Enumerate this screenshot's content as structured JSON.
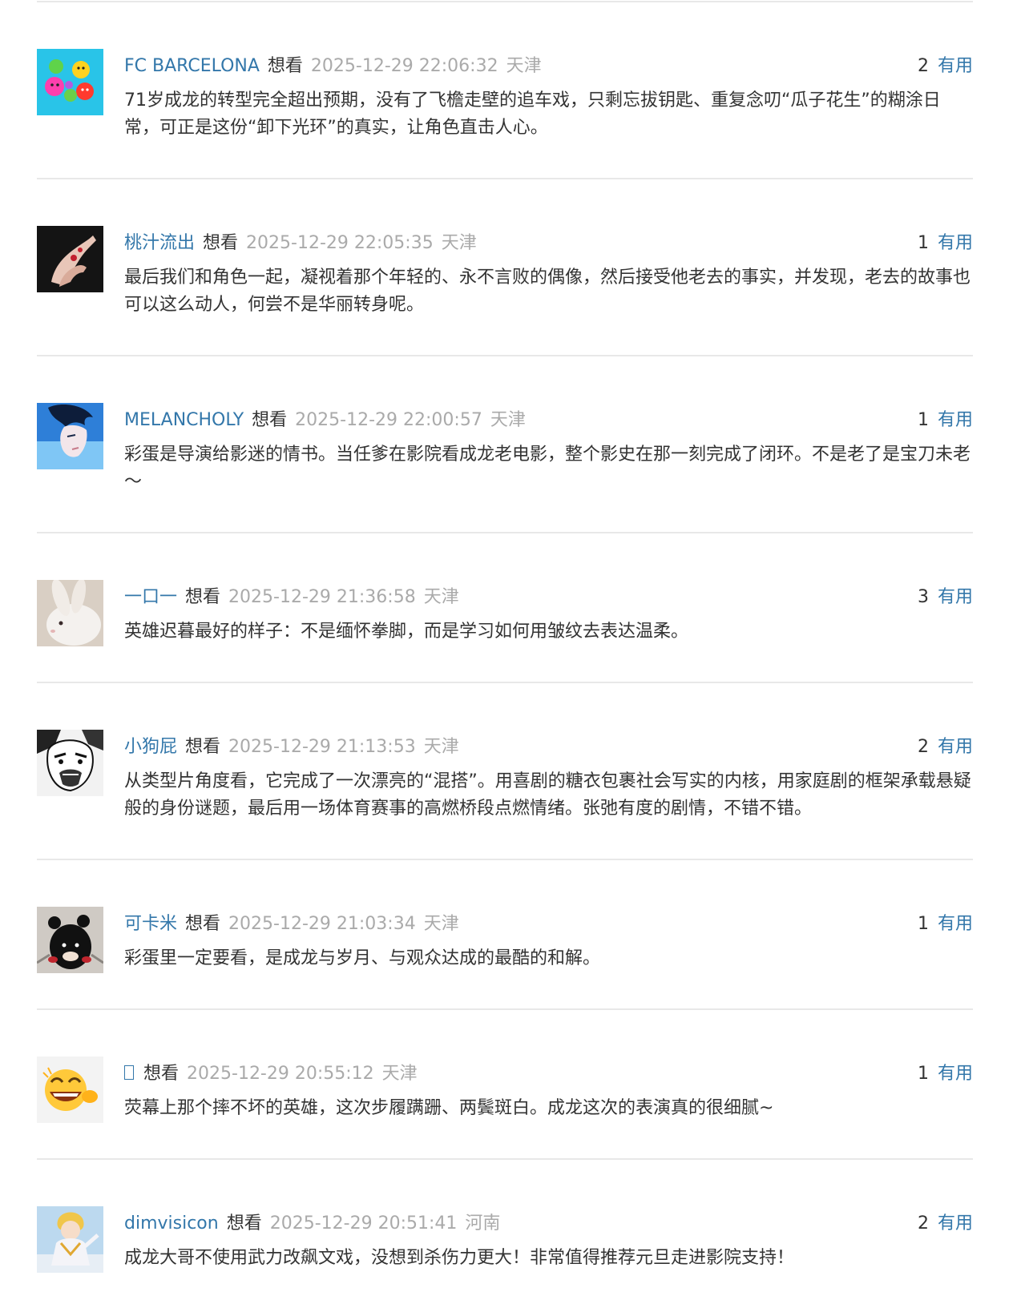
{
  "comments": [
    {
      "user": "FC BARCELONA",
      "rating": "想看",
      "time": "2025-12-29 22:06:32",
      "location": "天津",
      "useful_count": "2",
      "useful_label": "有用",
      "text": "71岁成龙的转型完全超出预期，没有了飞檐走壁的追车戏，只剩忘拔钥匙、重复念叨“瓜子花生”的糊涂日常，可正是这份“卸下光环”的真实，让角色直击人心。",
      "avatar": "colorful-balls-avatar"
    },
    {
      "user": "桃汁流出",
      "rating": "想看",
      "time": "2025-12-29 22:05:35",
      "location": "天津",
      "useful_count": "1",
      "useful_label": "有用",
      "text": "最后我们和角色一起，凝视着那个年轻的、永不言败的偶像，然后接受他老去的事实，并发现，老去的故事也可以这么动人，何尝不是华丽转身呢。",
      "avatar": "hands-dark-avatar"
    },
    {
      "user": "MELANCHOLY",
      "rating": "想看",
      "time": "2025-12-29 22:00:57",
      "location": "天津",
      "useful_count": "1",
      "useful_label": "有用",
      "text": "彩蛋是导演给影迷的情书。当任爹在影院看成龙老电影，整个影史在那一刻完成了闭环。不是老了是宝刀未老～",
      "avatar": "anime-boy-avatar"
    },
    {
      "user": "一口一",
      "rating": "想看",
      "time": "2025-12-29 21:36:58",
      "location": "天津",
      "useful_count": "3",
      "useful_label": "有用",
      "text": "英雄迟暮最好的样子：不是缅怀拳脚，而是学习如何用皱纹去表达温柔。",
      "avatar": "white-rabbit-avatar"
    },
    {
      "user": "小狗屁",
      "rating": "想看",
      "time": "2025-12-29 21:13:53",
      "location": "天津",
      "useful_count": "2",
      "useful_label": "有用",
      "text": "从类型片角度看，它完成了一次漂亮的“混搭”。用喜剧的糖衣包裹社会写实的内核，用家庭剧的框架承载悬疑般的身份谜题，最后用一场体育赛事的高燃桥段点燃情绪。张弛有度的剧情，不错不错。",
      "avatar": "manga-face-avatar"
    },
    {
      "user": "可卡米",
      "rating": "想看",
      "time": "2025-12-29 21:03:34",
      "location": "天津",
      "useful_count": "1",
      "useful_label": "有用",
      "text": "彩蛋里一定要看，是成龙与岁月、与观众达成的最酷的和解。",
      "avatar": "black-bear-plush-avatar"
    },
    {
      "user": "",
      "rating": "想看",
      "time": "2025-12-29 20:55:12",
      "location": "天津",
      "useful_count": "1",
      "useful_label": "有用",
      "text": "荧幕上那个摔不坏的英雄，这次步履蹒跚、两鬓斑白。成龙这次的表演真的很细腻~",
      "avatar": "laughing-emoji-avatar"
    },
    {
      "user": "dimvisicon",
      "rating": "想看",
      "time": "2025-12-29 20:51:41",
      "location": "河南",
      "useful_count": "2",
      "useful_label": "有用",
      "text": "成龙大哥不使用武力改飙文戏，没想到杀伤力更大！非常值得推荐元旦走进影院支持！",
      "avatar": "anime-character-avatar"
    }
  ]
}
